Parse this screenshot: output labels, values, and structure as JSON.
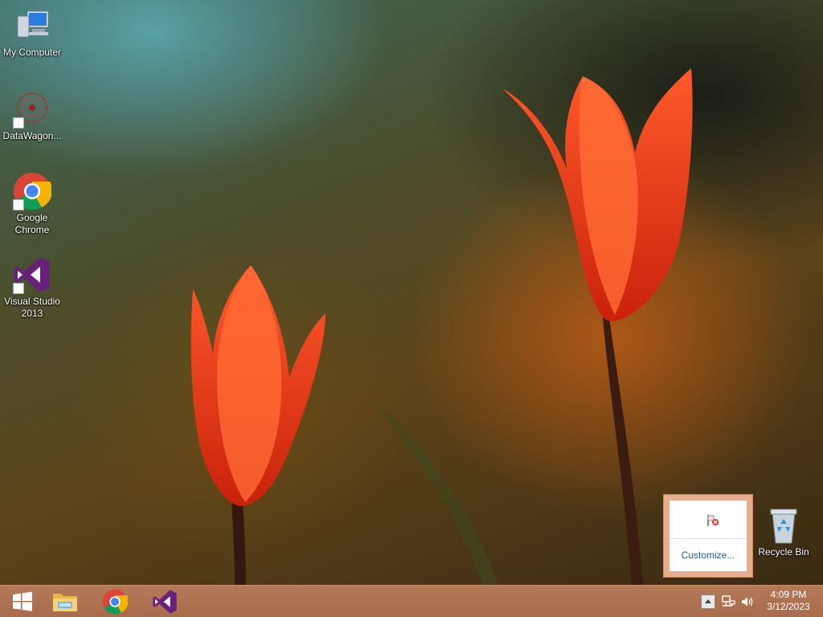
{
  "desktop_icons": [
    {
      "label": "My Computer",
      "icon": "computer-icon"
    },
    {
      "label": "DataWagon...",
      "icon": "datawagon-icon"
    },
    {
      "label": "Google Chrome",
      "icon": "chrome-icon"
    },
    {
      "label": "Visual Studio 2013",
      "icon": "visual-studio-icon"
    },
    {
      "label": "Recycle Bin",
      "icon": "recycle-bin-icon"
    }
  ],
  "tray_popup": {
    "customize_label": "Customize...",
    "icon": "action-center-flag-icon"
  },
  "taskbar": {
    "start_icon": "windows-logo-icon",
    "pinned": [
      {
        "name": "File Explorer",
        "icon": "folder-icon"
      },
      {
        "name": "Google Chrome",
        "icon": "chrome-icon"
      },
      {
        "name": "Visual Studio 2013",
        "icon": "visual-studio-icon"
      }
    ],
    "tray_icons": [
      "show-hidden-icons-icon",
      "network-icon",
      "volume-icon"
    ],
    "clock": {
      "time": "4:09 PM",
      "date": "3/12/2023"
    }
  },
  "colors": {
    "taskbar": "#ae7352",
    "popup_frame": "#e7ae8d",
    "link": "#1e5d96"
  }
}
